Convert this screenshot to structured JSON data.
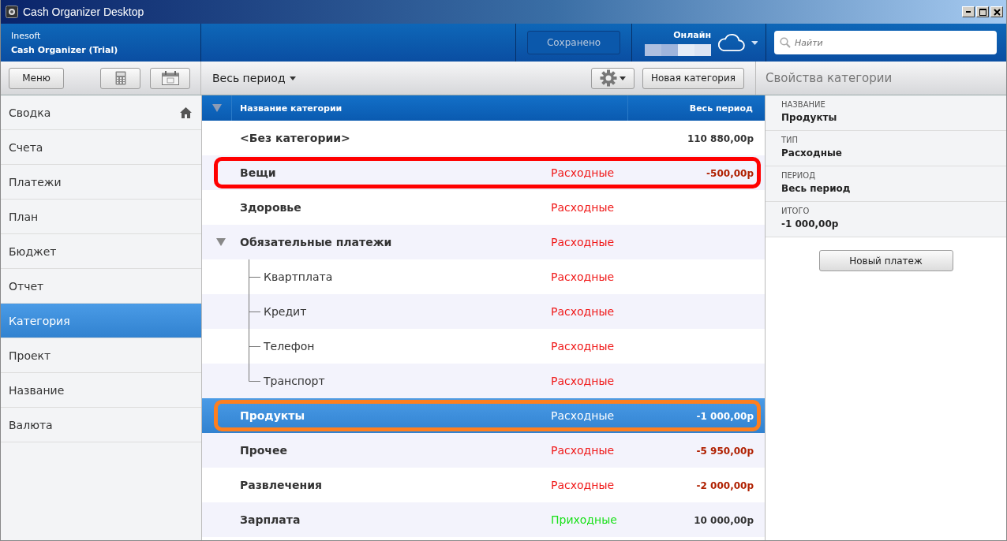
{
  "window": {
    "title": "Cash Organizer Desktop"
  },
  "header": {
    "company": "Inesoft",
    "product": "Cash Organizer (Trial)",
    "save_status": "Сохранено",
    "online_label": "Онлайн",
    "search": {
      "placeholder": "Найти"
    }
  },
  "toolbar": {
    "menu_button": "Меню",
    "period": "Весь период",
    "new_category_button": "Новая категория",
    "panel_title": "Свойства категории"
  },
  "sidebar": {
    "items": [
      {
        "label": "Сводка",
        "selected": false,
        "home": true
      },
      {
        "label": "Счета",
        "selected": false
      },
      {
        "label": "Платежи",
        "selected": false
      },
      {
        "label": "План",
        "selected": false
      },
      {
        "label": "Бюджет",
        "selected": false
      },
      {
        "label": "Отчет",
        "selected": false
      },
      {
        "label": "Категория",
        "selected": true
      },
      {
        "label": "Проект",
        "selected": false
      },
      {
        "label": "Название",
        "selected": false
      },
      {
        "label": "Валюта",
        "selected": false
      }
    ]
  },
  "table": {
    "expanded": true,
    "columns": [
      "Название категории",
      "Весь период"
    ],
    "rows": [
      {
        "name": "<Без категории>",
        "kind": "none",
        "amount": "110 880,00р",
        "selected": false
      },
      {
        "name": "Вещи",
        "type": "Расходные",
        "kind": "expense",
        "amount": "-500,00р",
        "selected": false,
        "color": "#ff0000"
      },
      {
        "name": "Здоровье",
        "type": "Расходные",
        "kind": "expense",
        "selected": false
      },
      {
        "name": "Обязательные платежи",
        "type": "Расходные",
        "kind": "expense",
        "selected": false,
        "expanded": true,
        "children": [
          {
            "name": "Квартплата",
            "type": "Расходные",
            "kind": "expense",
            "selected": false
          },
          {
            "name": "Кредит",
            "type": "Расходные",
            "kind": "expense",
            "selected": false
          },
          {
            "name": "Телефон",
            "type": "Расходные",
            "kind": "expense",
            "selected": false
          },
          {
            "name": "Транспорт",
            "type": "Расходные",
            "kind": "expense",
            "selected": false
          }
        ]
      },
      {
        "name": "Продукты",
        "type": "Расходные",
        "kind": "expense",
        "amount": "-1 000,00р",
        "selected": true,
        "color": "#ff7f1e"
      },
      {
        "name": "Прочее",
        "type": "Расходные",
        "kind": "expense",
        "amount": "-5 950,00р",
        "selected": false
      },
      {
        "name": "Развлечения",
        "type": "Расходные",
        "kind": "expense",
        "amount": "-2 000,00р",
        "selected": false
      },
      {
        "name": "Зарплата",
        "type": "Приходные",
        "kind": "income",
        "amount": "10 000,00р",
        "selected": false
      }
    ]
  },
  "properties": {
    "fields": [
      {
        "label": "НАЗВАНИЕ",
        "value": "Продукты"
      },
      {
        "label": "ТИП",
        "value": "Расходные"
      },
      {
        "label": "ПЕРИОД",
        "value": "Весь период"
      },
      {
        "label": "ИТОГО",
        "value": "-1 000,00р"
      }
    ],
    "button": "Новый платеж"
  }
}
